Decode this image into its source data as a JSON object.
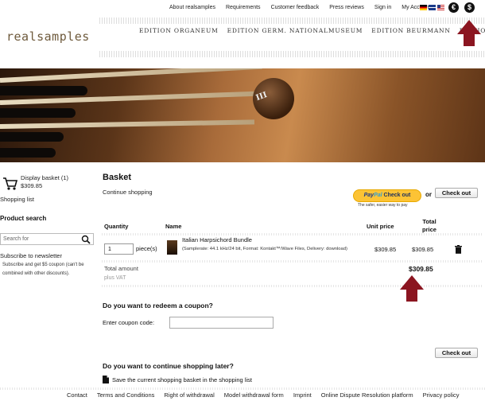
{
  "topnav": [
    "About realsamples",
    "Requirements",
    "Customer feedback",
    "Press reviews",
    "Sign in",
    "My Account"
  ],
  "currencies": [
    "€",
    "$"
  ],
  "brand": "realsamples",
  "editions": [
    "EDITION ORGANEUM",
    "EDITION GERM. NATIONALMUSEUM",
    "EDITION BEURMANN",
    "EDITION"
  ],
  "hero_mark": "III",
  "sidebar": {
    "basket_label": "Display basket (1)",
    "basket_total": "$309.85",
    "shopping_list": "Shopping list",
    "product_search_title": "Product search",
    "search_placeholder": "Search for",
    "newsletter_title": "Subscribe to newsletter",
    "newsletter_text": "Subscribe and get $5 coupon (can't be combined with other discounts)."
  },
  "basket": {
    "title": "Basket",
    "continue_shopping": "Continue shopping",
    "paypal_label_1": "Pay",
    "paypal_label_2": "Pal",
    "paypal_checkout": "Check out",
    "paypal_tagline": "The safer, easier way to pay",
    "or": "or",
    "checkout_label": "Check out",
    "headers": {
      "quantity": "Quantity",
      "name": "Name",
      "unit_price": "Unit price",
      "total_price": "Total price"
    },
    "item": {
      "quantity": "1",
      "pieces_label": "piece(s)",
      "name": "Italian Harpsichord Bundle",
      "description": "(Samplerate: 44.1 kHz/24 bit, Format: Kontakt™/Wave Files, Delivery: download)",
      "unit_price": "$309.85",
      "total_price": "$309.85"
    },
    "total_label": "Total amount",
    "total_amount": "$309.85",
    "vat_note": "plus VAT"
  },
  "coupon": {
    "title": "Do you want to redeem a coupon?",
    "label": "Enter coupon code:",
    "value": ""
  },
  "later": {
    "title": "Do you want to continue shopping later?",
    "save_text": "Save the current shopping basket in the shopping list"
  },
  "footer": [
    "Contact",
    "Terms and Conditions",
    "Right of withdrawal",
    "Model withdrawal form",
    "Imprint",
    "Online Dispute Resolution platform",
    "Privacy policy"
  ],
  "colors": {
    "arrow": "#8b1520",
    "brand": "#6e5a3c",
    "paypal": "#fcc335"
  }
}
